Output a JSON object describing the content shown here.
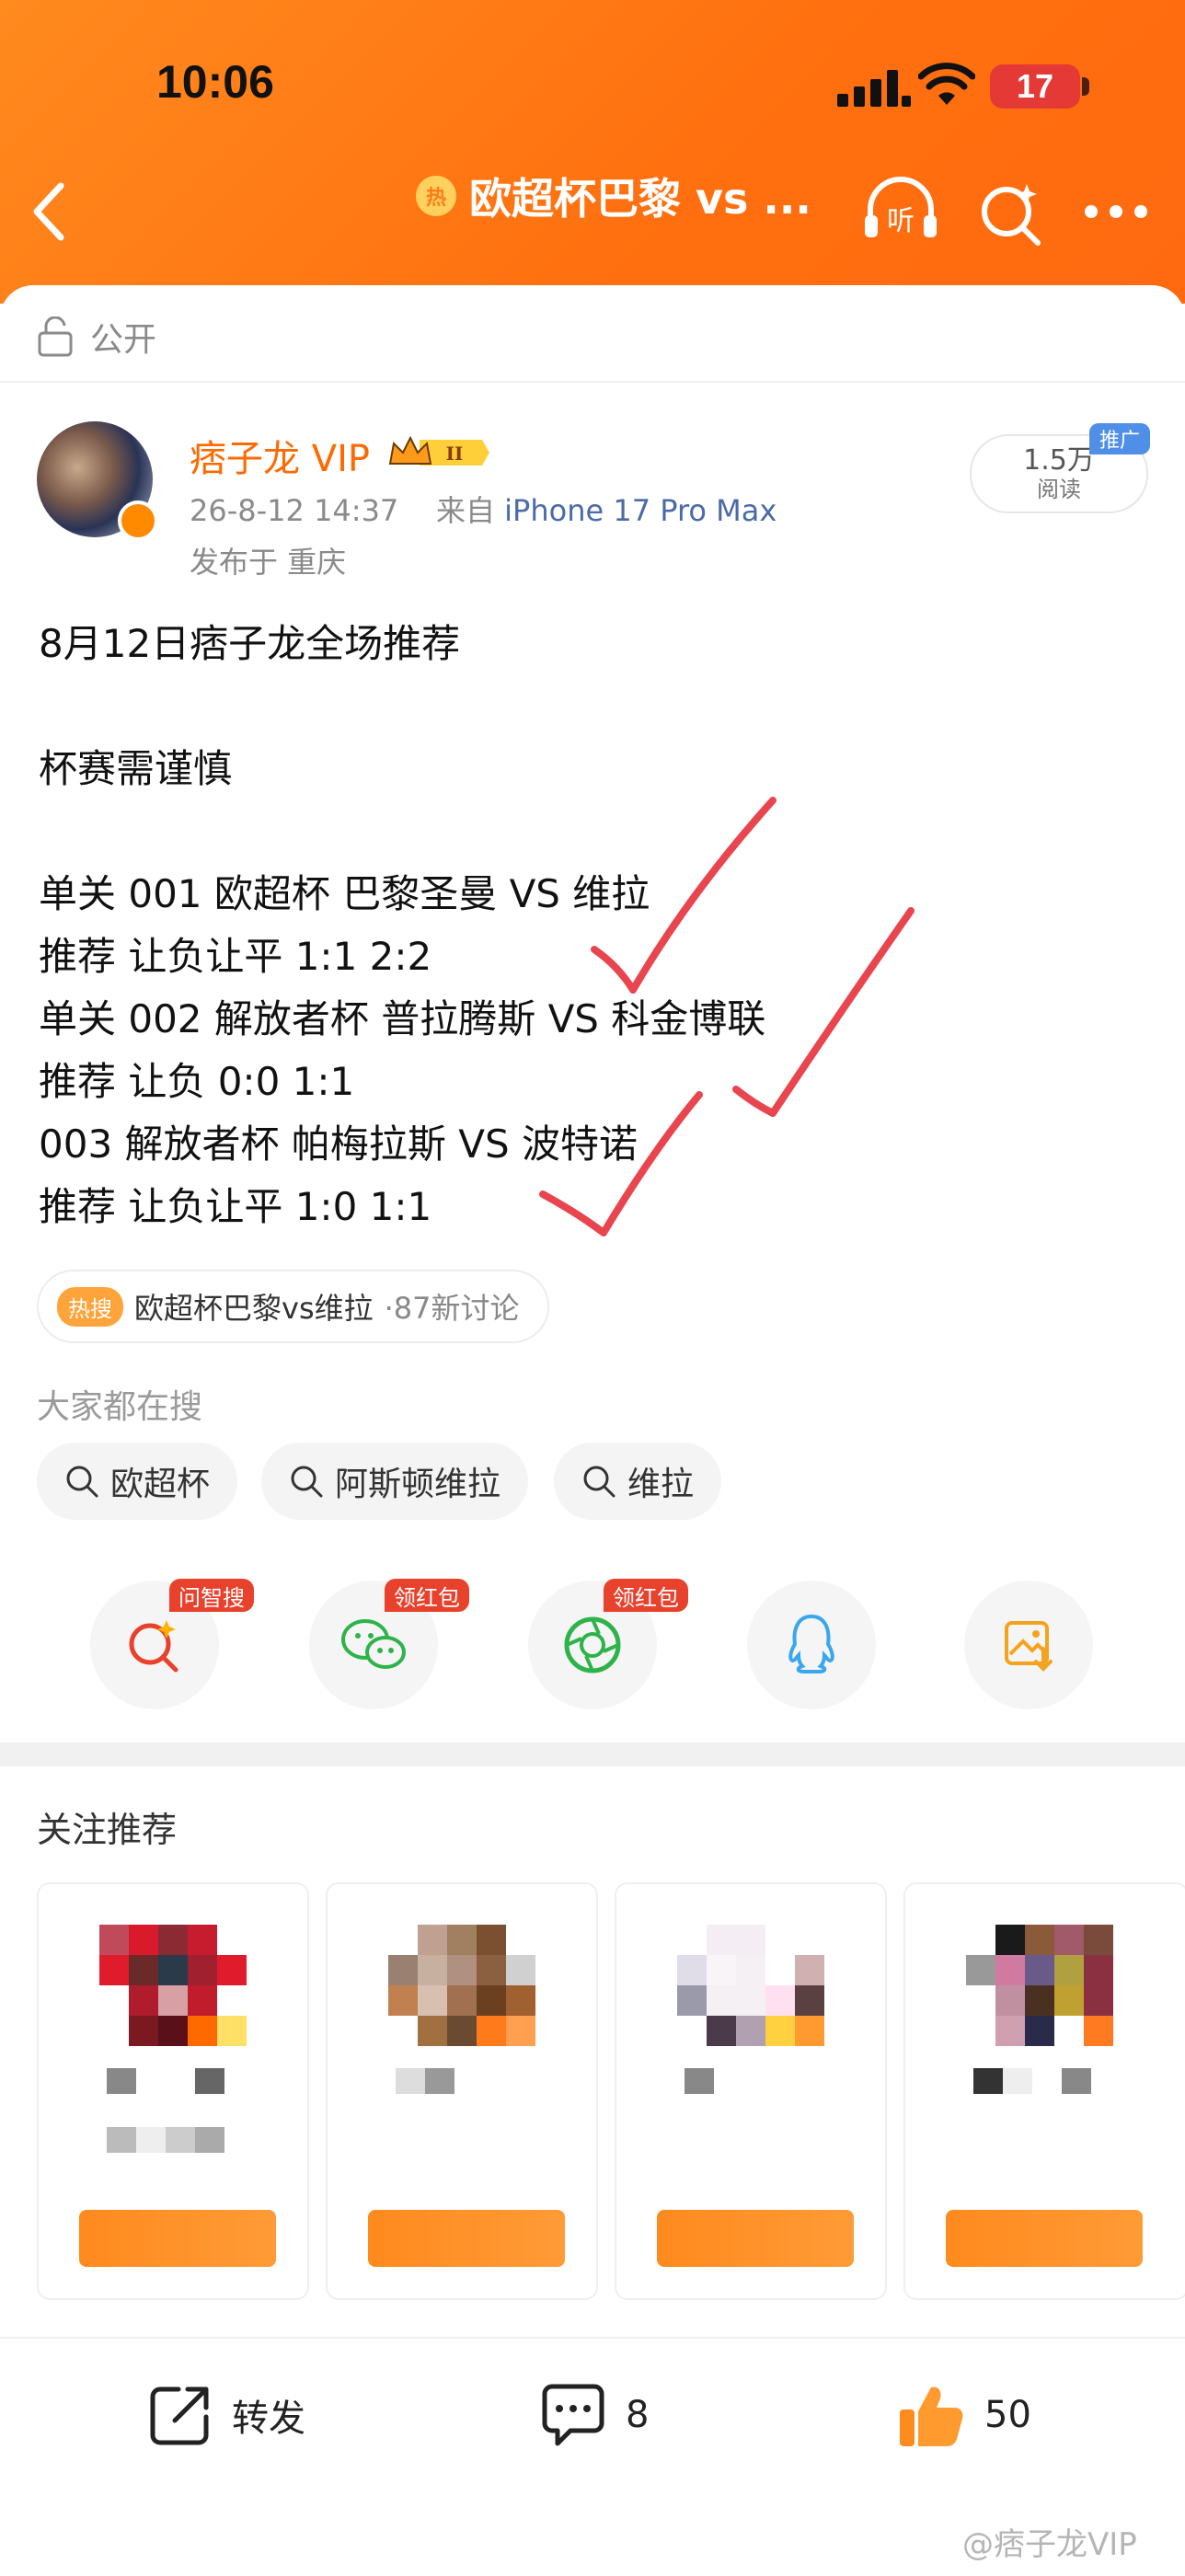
{
  "status_bar": {
    "time": "10:06",
    "battery": "17"
  },
  "nav": {
    "hot_label": "热",
    "title": "欧超杯巴黎 vs ...",
    "listen_label": "听"
  },
  "visibility": "公开",
  "author": {
    "name": "痞子龙 VIP",
    "level_badge": "II",
    "time": "26-8-12 14:37",
    "from_label": "来自",
    "device": "iPhone 17 Pro Max",
    "location": "发布于 重庆"
  },
  "reads": {
    "count": "1.5万",
    "label": "阅读",
    "promo": "推广"
  },
  "post": {
    "lines": [
      "8月12日痞子龙全场推荐",
      "杯赛需谨慎",
      "单关 001 欧超杯 巴黎圣曼 VS 维拉",
      "推荐 让负让平 1:1 2:2",
      "单关 002 解放者杯 普拉腾斯 VS 科金博联",
      "推荐 让负 0:0 1:1",
      "003 解放者杯 帕梅拉斯 VS 波特诺",
      "推荐 让负让平 1:0 1:1"
    ]
  },
  "topic": {
    "tag": "热搜",
    "text": "欧超杯巴黎vs维拉",
    "count": "·87新讨论"
  },
  "search_section": {
    "title": "大家都在搜",
    "items": [
      "欧超杯",
      "阿斯顿维拉",
      "维拉"
    ]
  },
  "share": {
    "badges": [
      "问智搜",
      "领红包",
      "领红包"
    ],
    "icons": [
      "ai-search-icon",
      "wechat-icon",
      "moments-icon",
      "qq-icon",
      "save-image-icon"
    ]
  },
  "recommend": {
    "title": "关注推荐"
  },
  "actions": {
    "repost": "转发",
    "comments": "8",
    "likes": "50"
  },
  "watermark": "@痞子龙VIP",
  "colors": {
    "header": "#ff7a18",
    "accent": "#ff6a00",
    "device_link": "#4a6ba8",
    "badge_red": "#e8412c"
  }
}
